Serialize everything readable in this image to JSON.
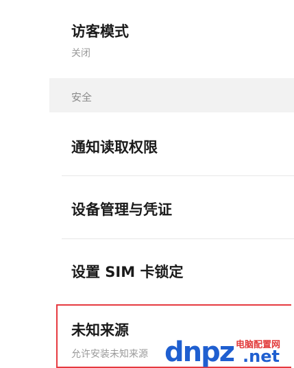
{
  "settings": {
    "guest_mode": {
      "title": "访客模式",
      "status": "关闭"
    },
    "security_section": {
      "label": "安全"
    },
    "notification_access": {
      "title": "通知读取权限"
    },
    "device_admin": {
      "title": "设备管理与凭证"
    },
    "sim_lock": {
      "title": "设置 SIM 卡锁定"
    },
    "unknown_sources": {
      "title": "未知来源",
      "description": "允许安装未知来源"
    }
  },
  "watermark": {
    "brand": "dnpz",
    "cn_text": "电脑配置网",
    "tld": ".net"
  },
  "colors": {
    "highlight_border": "#e6393f",
    "section_bg": "#f2f2f2",
    "watermark_blue": "#1f5fd0",
    "watermark_red": "#e23a3a"
  }
}
